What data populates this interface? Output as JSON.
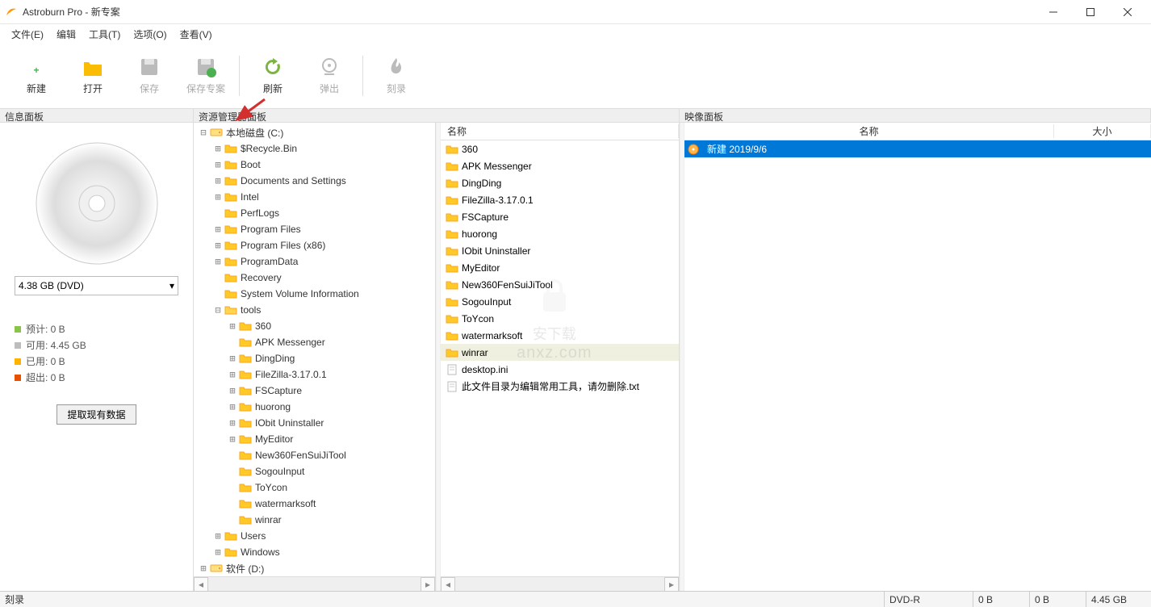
{
  "app": {
    "title": "Astroburn Pro - 新专案"
  },
  "menus": [
    "文件(E)",
    "编辑",
    "工具(T)",
    "选项(O)",
    "查看(V)"
  ],
  "toolbar": [
    {
      "id": "new",
      "label": "新建",
      "color": "#4caf50",
      "disabled": false
    },
    {
      "id": "open",
      "label": "打开",
      "color": "#fbbc04",
      "disabled": false
    },
    {
      "id": "save",
      "label": "保存",
      "color": "#bbb",
      "disabled": true
    },
    {
      "id": "save-project",
      "label": "保存专案",
      "color": "#bbb",
      "disabled": true
    },
    {
      "id": "refresh",
      "label": "刷新",
      "color": "#7cb342",
      "disabled": false
    },
    {
      "id": "eject",
      "label": "弹出",
      "color": "#bbb",
      "disabled": true
    },
    {
      "id": "burn",
      "label": "刻录",
      "color": "#bbb",
      "disabled": true
    }
  ],
  "panel_titles": {
    "info": "信息面板",
    "explorer": "资源管理器面板",
    "image": "映像面板"
  },
  "disc": {
    "select_label": "4.38 GB (DVD)"
  },
  "stats": {
    "estimate": {
      "label": "预计:",
      "value": "0 B",
      "color": "#8bc34a"
    },
    "available": {
      "label": "可用:",
      "value": "4.45 GB",
      "color": "#bdbdbd"
    },
    "used": {
      "label": "已用:",
      "value": "0 B",
      "color": "#ffb300"
    },
    "exceed": {
      "label": "超出:",
      "value": "0 B",
      "color": "#e65100"
    }
  },
  "extract_btn": "提取现有数据",
  "tree": [
    {
      "d": 0,
      "exp": "-",
      "label": "本地磁盘 (C:)",
      "type": "drive"
    },
    {
      "d": 1,
      "exp": "+",
      "label": "$Recycle.Bin",
      "type": "folder"
    },
    {
      "d": 1,
      "exp": "+",
      "label": "Boot",
      "type": "folder"
    },
    {
      "d": 1,
      "exp": "+",
      "label": "Documents and Settings",
      "type": "folder"
    },
    {
      "d": 1,
      "exp": "+",
      "label": "Intel",
      "type": "folder"
    },
    {
      "d": 1,
      "exp": "",
      "label": "PerfLogs",
      "type": "folder"
    },
    {
      "d": 1,
      "exp": "+",
      "label": "Program Files",
      "type": "folder"
    },
    {
      "d": 1,
      "exp": "+",
      "label": "Program Files (x86)",
      "type": "folder"
    },
    {
      "d": 1,
      "exp": "+",
      "label": "ProgramData",
      "type": "folder"
    },
    {
      "d": 1,
      "exp": "",
      "label": "Recovery",
      "type": "folder"
    },
    {
      "d": 1,
      "exp": "",
      "label": "System Volume Information",
      "type": "folder"
    },
    {
      "d": 1,
      "exp": "-",
      "label": "tools",
      "type": "folder-open"
    },
    {
      "d": 2,
      "exp": "+",
      "label": "360",
      "type": "folder"
    },
    {
      "d": 2,
      "exp": "",
      "label": "APK Messenger",
      "type": "folder"
    },
    {
      "d": 2,
      "exp": "+",
      "label": "DingDing",
      "type": "folder"
    },
    {
      "d": 2,
      "exp": "+",
      "label": "FileZilla-3.17.0.1",
      "type": "folder"
    },
    {
      "d": 2,
      "exp": "+",
      "label": "FSCapture",
      "type": "folder"
    },
    {
      "d": 2,
      "exp": "+",
      "label": "huorong",
      "type": "folder"
    },
    {
      "d": 2,
      "exp": "+",
      "label": "IObit Uninstaller",
      "type": "folder"
    },
    {
      "d": 2,
      "exp": "+",
      "label": "MyEditor",
      "type": "folder"
    },
    {
      "d": 2,
      "exp": "",
      "label": "New360FenSuiJiTool",
      "type": "folder"
    },
    {
      "d": 2,
      "exp": "",
      "label": "SogouInput",
      "type": "folder"
    },
    {
      "d": 2,
      "exp": "",
      "label": "ToYcon",
      "type": "folder"
    },
    {
      "d": 2,
      "exp": "",
      "label": "watermarksoft",
      "type": "folder"
    },
    {
      "d": 2,
      "exp": "",
      "label": "winrar",
      "type": "folder"
    },
    {
      "d": 1,
      "exp": "+",
      "label": "Users",
      "type": "folder"
    },
    {
      "d": 1,
      "exp": "+",
      "label": "Windows",
      "type": "folder"
    },
    {
      "d": 0,
      "exp": "+",
      "label": "软件 (D:)",
      "type": "drive"
    }
  ],
  "file_header": "名称",
  "files": [
    {
      "name": "360",
      "type": "folder"
    },
    {
      "name": "APK Messenger",
      "type": "folder"
    },
    {
      "name": "DingDing",
      "type": "folder"
    },
    {
      "name": "FileZilla-3.17.0.1",
      "type": "folder"
    },
    {
      "name": "FSCapture",
      "type": "folder"
    },
    {
      "name": "huorong",
      "type": "folder"
    },
    {
      "name": "IObit Uninstaller",
      "type": "folder"
    },
    {
      "name": "MyEditor",
      "type": "folder"
    },
    {
      "name": "New360FenSuiJiTool",
      "type": "folder"
    },
    {
      "name": "SogouInput",
      "type": "folder"
    },
    {
      "name": "ToYcon",
      "type": "folder"
    },
    {
      "name": "watermarksoft",
      "type": "folder"
    },
    {
      "name": "winrar",
      "type": "folder",
      "selected": true
    },
    {
      "name": "desktop.ini",
      "type": "file"
    },
    {
      "name": "此文件目录为编辑常用工具，请勿删除.txt",
      "type": "file"
    }
  ],
  "image_cols": {
    "name": "名称",
    "size": "大小"
  },
  "image_items": [
    {
      "name": "新建 2019/9/6",
      "selected": true
    }
  ],
  "statusbar": {
    "label": "刻录",
    "type": "DVD-R",
    "v1": "0 B",
    "v2": "0 B",
    "v3": "4.45 GB"
  },
  "watermark": {
    "text": "anxz.com",
    "sub": "安下载"
  }
}
